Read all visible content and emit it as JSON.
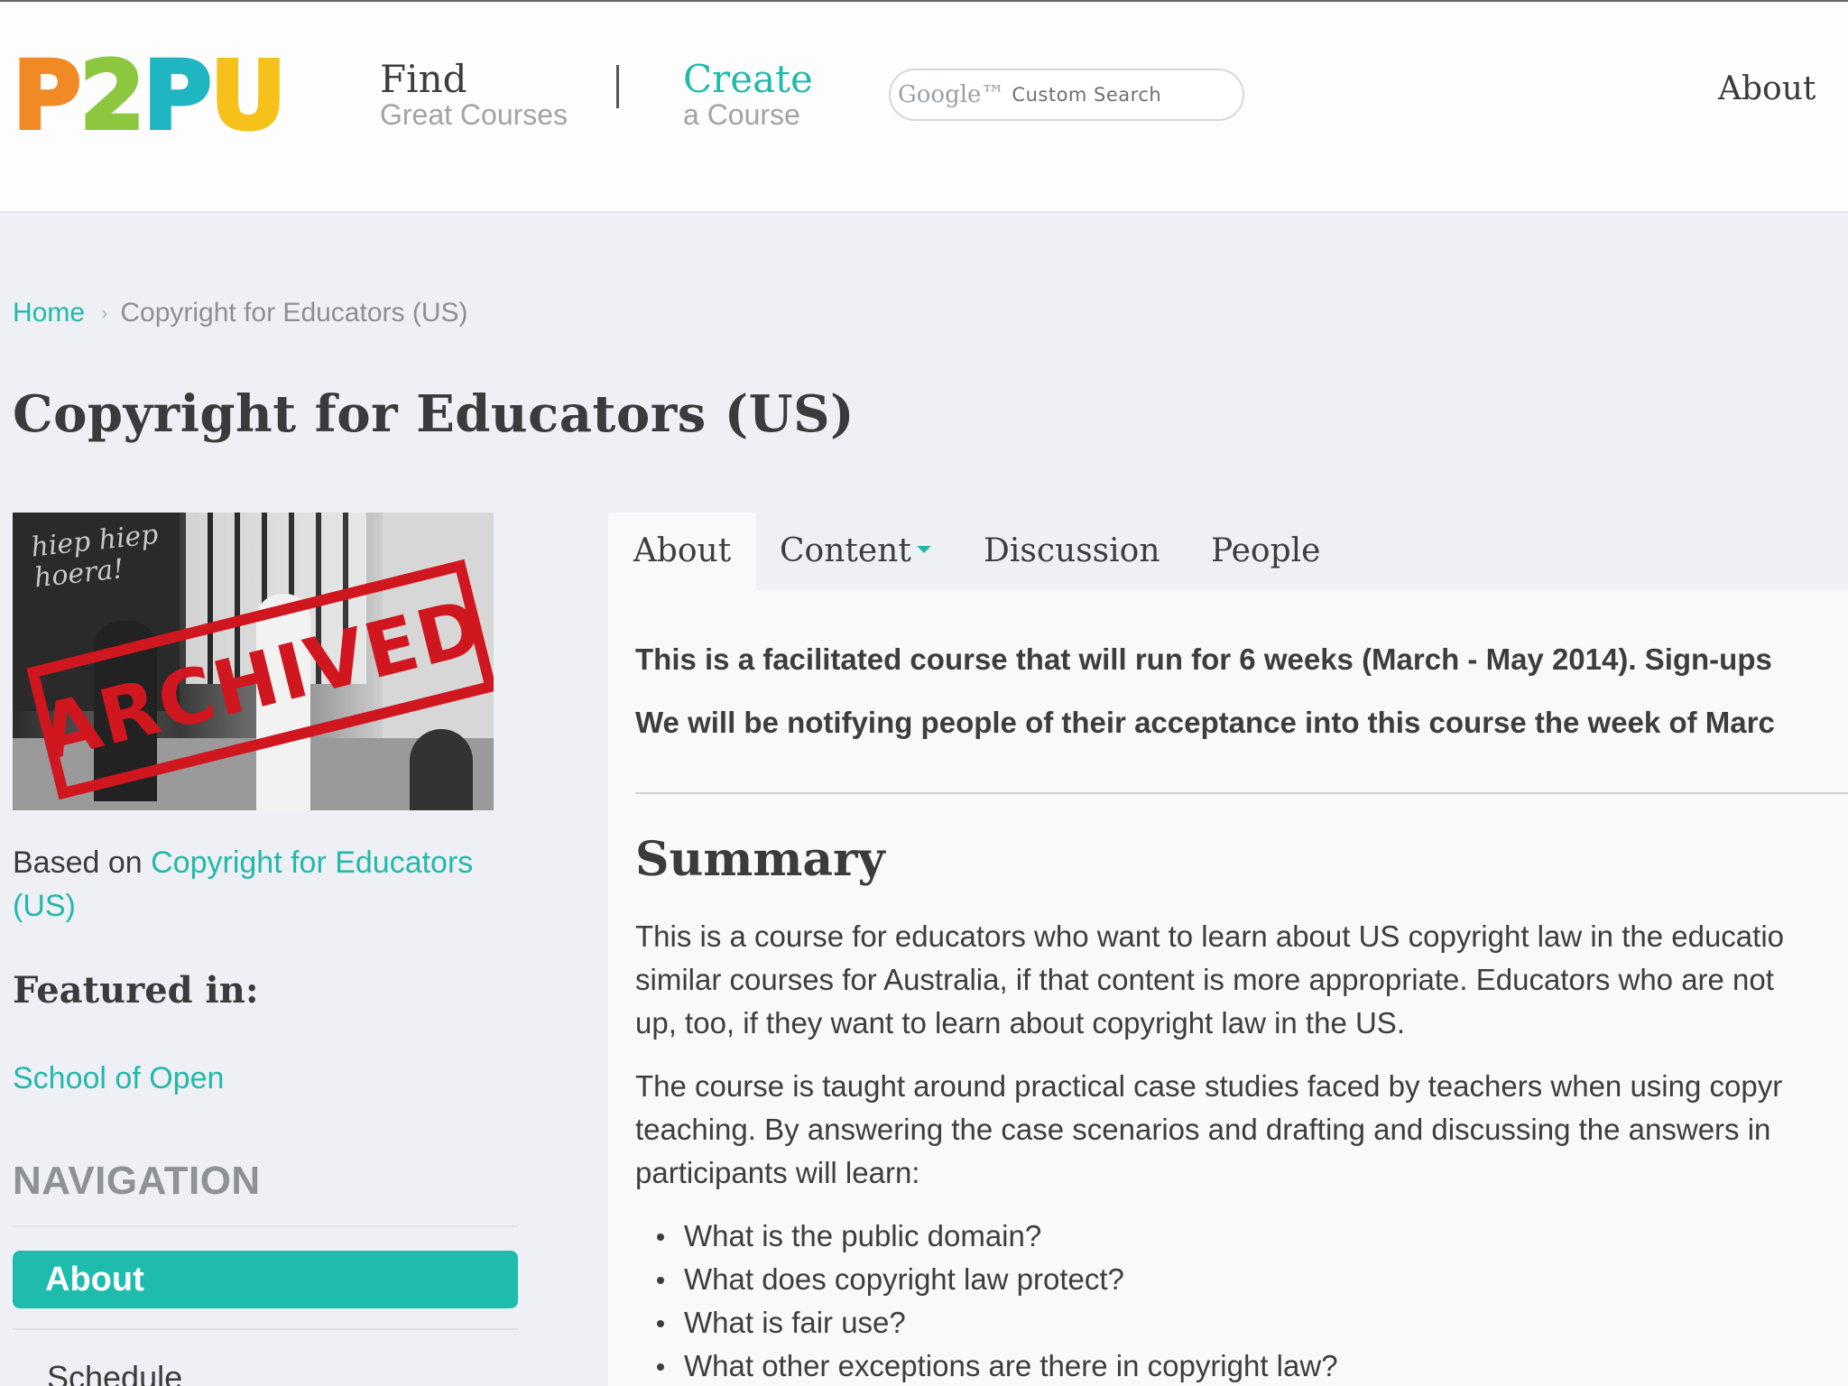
{
  "header": {
    "logo": [
      "P",
      "2",
      "P",
      "U"
    ],
    "find": {
      "main": "Find",
      "sub": "Great Courses"
    },
    "create": {
      "main": "Create",
      "sub": "a Course"
    },
    "search": {
      "brand": "Google™",
      "placeholder": "Custom Search"
    },
    "about": "About"
  },
  "breadcrumb": {
    "home": "Home",
    "separator": "›",
    "current": "Copyright for Educators (US)"
  },
  "page_title": "Copyright for Educators (US)",
  "sidebar": {
    "image_stamp": "ARCHIVED",
    "image_board_text": "hiep hiep hoera!",
    "based_on_prefix": "Based on ",
    "based_on_link": "Copyright for Educators (US)",
    "featured_heading": "Featured in:",
    "featured_link": "School of Open",
    "nav_heading": "NAVIGATION",
    "nav_items": [
      "About",
      "Schedule"
    ]
  },
  "tabs": [
    "About",
    "Content",
    "Discussion",
    "People"
  ],
  "main": {
    "notice_1": "This is a facilitated course that will run for 6 weeks (March - May 2014). Sign-ups",
    "notice_2": "We will be notifying people of their acceptance into this course the week of Marc",
    "summary_heading": "Summary",
    "para1": [
      "This is a course for educators who want to learn about US copyright law in the educatio",
      "similar courses for Australia, if that content is more appropriate. Educators who are not",
      "up, too, if they want to learn about copyright law in the US."
    ],
    "para2": [
      "The course is taught around practical case studies faced by teachers when using copyr",
      "teaching. By answering the case scenarios and drafting and discussing the answers in",
      "participants will learn:"
    ],
    "bullets": [
      "What is the public domain?",
      "What does copyright law protect?",
      "What is fair use?",
      "What other exceptions are there in copyright law?"
    ]
  },
  "colors": {
    "accent": "#23b9a9",
    "stamp": "#d0161e",
    "logo": [
      "#f08a24",
      "#8dc63f",
      "#1fb6c1",
      "#f5c11a"
    ]
  }
}
